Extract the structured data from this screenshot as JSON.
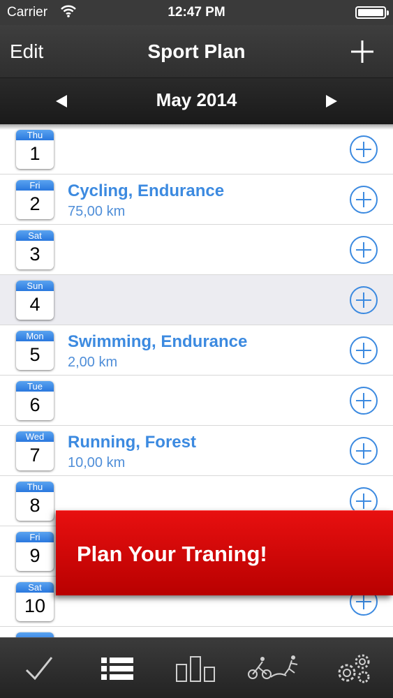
{
  "status_bar": {
    "carrier": "Carrier",
    "time": "12:47 PM"
  },
  "nav": {
    "edit_label": "Edit",
    "title": "Sport Plan",
    "add_icon": "plus-icon"
  },
  "month_selector": {
    "label": "May 2014"
  },
  "days": [
    {
      "dow": "Thu",
      "day": "1",
      "activity": "",
      "distance": ""
    },
    {
      "dow": "Fri",
      "day": "2",
      "activity": "Cycling, Endurance",
      "distance": "75,00 km"
    },
    {
      "dow": "Sat",
      "day": "3",
      "activity": "",
      "distance": ""
    },
    {
      "dow": "Sun",
      "day": "4",
      "activity": "",
      "distance": ""
    },
    {
      "dow": "Mon",
      "day": "5",
      "activity": "Swimming, Endurance",
      "distance": "2,00 km"
    },
    {
      "dow": "Tue",
      "day": "6",
      "activity": "",
      "distance": ""
    },
    {
      "dow": "Wed",
      "day": "7",
      "activity": "Running, Forest",
      "distance": "10,00 km"
    },
    {
      "dow": "Thu",
      "day": "8",
      "activity": "",
      "distance": ""
    },
    {
      "dow": "Fri",
      "day": "9",
      "activity": "",
      "distance": ""
    },
    {
      "dow": "Sat",
      "day": "10",
      "activity": "",
      "distance": ""
    }
  ],
  "promo_banner": {
    "text": "Plan Your Traning!"
  },
  "tab_bar": {
    "tabs": [
      "checkmark-icon",
      "list-icon",
      "bar-chart-icon",
      "triathlon-icon",
      "settings-gears-icon"
    ]
  },
  "colors": {
    "accent_blue": "#3c8ae0",
    "banner_red": "#d40000",
    "bar_dark": "#2f2f2f"
  }
}
